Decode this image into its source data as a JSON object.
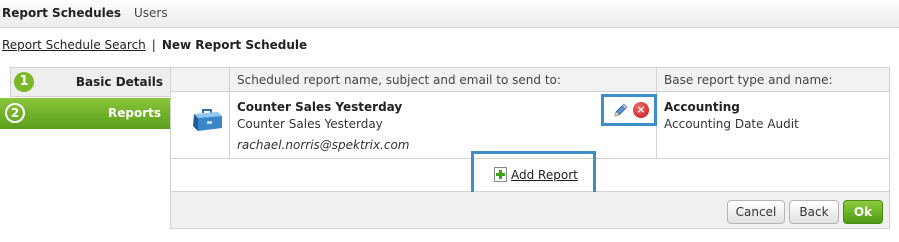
{
  "top_tabs": {
    "active": "Report Schedules",
    "users": "Users"
  },
  "breadcrumb": {
    "link": "Report Schedule Search",
    "separator": "|",
    "current": "New Report Schedule"
  },
  "steps": [
    {
      "number": "1",
      "label": "Basic Details"
    },
    {
      "number": "2",
      "label": "Reports"
    }
  ],
  "table": {
    "headers": {
      "col_report": "Scheduled report name, subject and email to send to:",
      "col_base": "Base report type and name:"
    },
    "row": {
      "icon": "toolbox-icon",
      "name": "Counter Sales Yesterday",
      "subject": "Counter Sales Yesterday",
      "email": "rachael.norris@spektrix.com",
      "base_type": "Accounting",
      "base_name": "Accounting Date Audit",
      "edit_icon": "pencil-icon",
      "delete_icon": "delete-icon",
      "delete_glyph": "×"
    },
    "add_report": "Add Report"
  },
  "buttons": {
    "cancel": "Cancel",
    "back": "Back",
    "ok": "Ok"
  },
  "colors": {
    "accent_green": "#7ab828",
    "highlight_blue": "#3d8ec9",
    "delete_red": "#c81414"
  }
}
